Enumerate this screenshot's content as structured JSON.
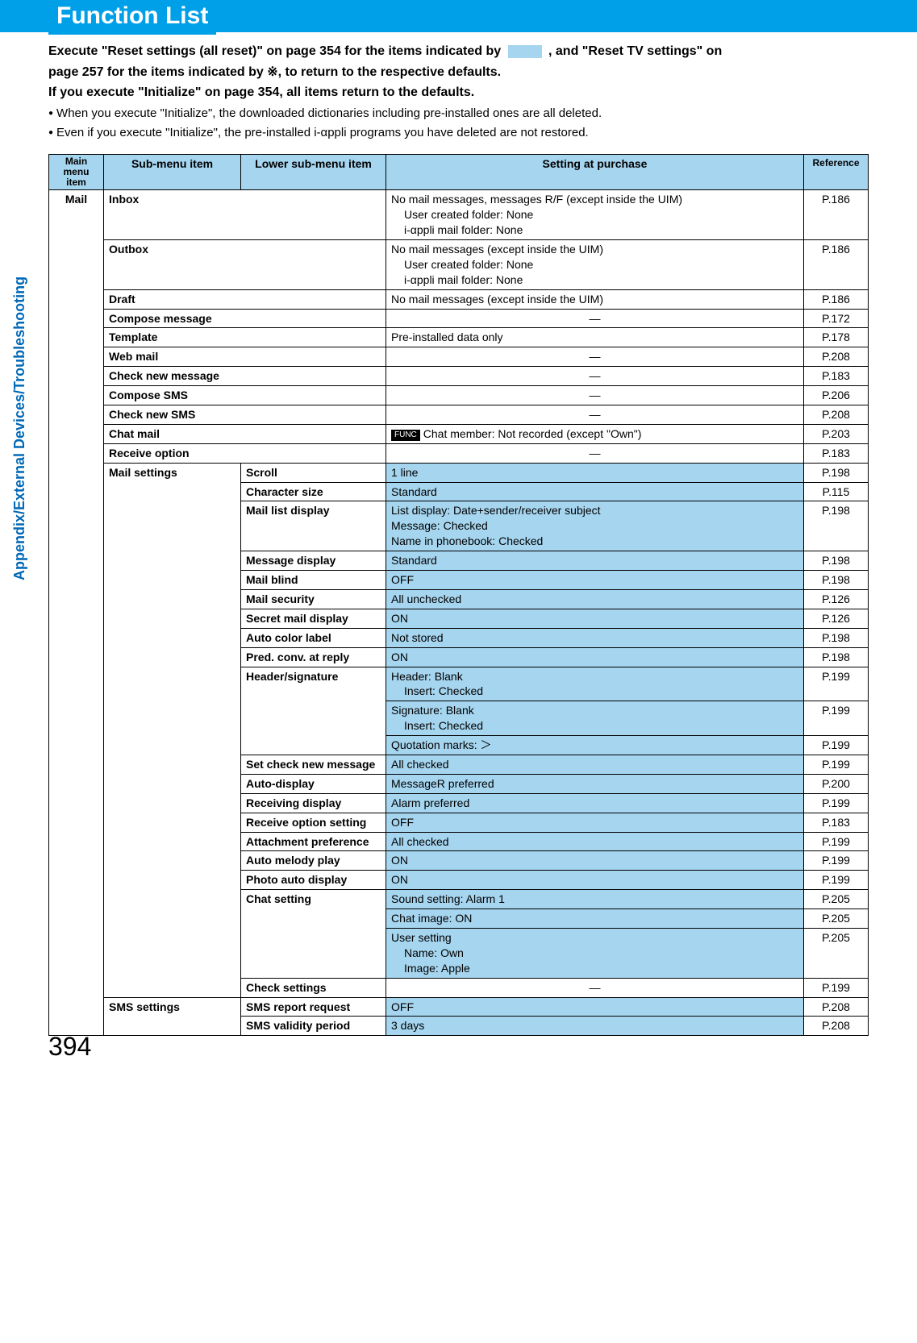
{
  "title": "Function List",
  "intro": {
    "line1a": "Execute \"Reset settings (all reset)\" on page 354 for the items indicated by ",
    "line1b": ", and \"Reset TV settings\" on",
    "line2": "page 257 for the items indicated by ※, to return to the respective defaults.",
    "line3": " If you execute \"Initialize\" on page 354, all items return to the defaults.",
    "bullet1": "When you execute \"Initialize\", the downloaded dictionaries including pre-installed ones are all deleted.",
    "bullet2": "Even if you execute \"Initialize\", the pre-installed i-αppli programs you have deleted are not restored."
  },
  "sidebar_text": "Appendix/External Devices/Troubleshooting",
  "page_number": "394",
  "headers": {
    "main": "Main\nmenu item",
    "sub": "Sub-menu item",
    "lower": "Lower sub-menu item",
    "setting": "Setting at purchase",
    "ref": "Reference"
  },
  "main_item": "Mail",
  "func_label": "FUNC",
  "dash": "—",
  "rows": {
    "inbox": {
      "sub": "Inbox",
      "setting_l1": "No mail messages, messages R/F (except inside the UIM)",
      "setting_l2": "User created folder: None",
      "setting_l3": "i-αppli mail folder: None",
      "ref": "P.186"
    },
    "outbox": {
      "sub": "Outbox",
      "setting_l1": "No mail messages (except inside the UIM)",
      "setting_l2": "User created folder: None",
      "setting_l3": "i-αppli mail folder: None",
      "ref": "P.186"
    },
    "draft": {
      "sub": "Draft",
      "setting": "No mail messages (except inside the UIM)",
      "ref": "P.186"
    },
    "compose": {
      "sub": "Compose message",
      "ref": "P.172"
    },
    "template": {
      "sub": "Template",
      "setting": "Pre-installed data only",
      "ref": "P.178"
    },
    "webmail": {
      "sub": "Web mail",
      "ref": "P.208"
    },
    "checknew": {
      "sub": "Check new message",
      "ref": "P.183"
    },
    "composesms": {
      "sub": "Compose SMS",
      "ref": "P.206"
    },
    "checknewsms": {
      "sub": "Check new SMS",
      "ref": "P.208"
    },
    "chatmail": {
      "sub": "Chat mail",
      "setting": "Chat member: Not recorded (except \"Own\")",
      "ref": "P.203"
    },
    "recvopt": {
      "sub": "Receive option",
      "ref": "P.183"
    },
    "mailsettings": {
      "sub": "Mail settings"
    },
    "scroll": {
      "lower": "Scroll",
      "setting": "1 line",
      "ref": "P.198"
    },
    "charsize": {
      "lower": "Character size",
      "setting": "Standard",
      "ref": "P.115"
    },
    "maillist": {
      "lower": "Mail list display",
      "l1": "List display: Date+sender/receiver subject",
      "l2": "Message: Checked",
      "l3": "Name in phonebook: Checked",
      "ref": "P.198"
    },
    "msgdisp": {
      "lower": "Message display",
      "setting": "Standard",
      "ref": "P.198"
    },
    "mailblind": {
      "lower": "Mail blind",
      "setting": "OFF",
      "ref": "P.198"
    },
    "mailsec": {
      "lower": "Mail security",
      "setting": "All unchecked",
      "ref": "P.126"
    },
    "secretmail": {
      "lower": "Secret mail display",
      "setting": "ON",
      "ref": "P.126"
    },
    "autocolor": {
      "lower": "Auto color label",
      "setting": "Not stored",
      "ref": "P.198"
    },
    "predconv": {
      "lower": "Pred. conv. at reply",
      "setting": "ON",
      "ref": "P.198"
    },
    "headersig": {
      "lower": "Header/signature",
      "l1": "Header: Blank",
      "l2": "Insert: Checked",
      "ref1": "P.199",
      "l3": "Signature: Blank",
      "l4": "Insert: Checked",
      "ref2": "P.199",
      "l5": "Quotation marks: ＞",
      "ref3": "P.199"
    },
    "setchecknew": {
      "lower": "Set check new message",
      "setting": "All checked",
      "ref": "P.199"
    },
    "autodisp": {
      "lower": "Auto-display",
      "setting": "MessageR preferred",
      "ref": "P.200"
    },
    "recvdisp": {
      "lower": "Receiving display",
      "setting": "Alarm preferred",
      "ref": "P.199"
    },
    "recvoptset": {
      "lower": "Receive option setting",
      "setting": "OFF",
      "ref": "P.183"
    },
    "attachpref": {
      "lower": "Attachment preference",
      "setting": "All checked",
      "ref": "P.199"
    },
    "automel": {
      "lower": "Auto melody play",
      "setting": "ON",
      "ref": "P.199"
    },
    "photoauto": {
      "lower": "Photo auto display",
      "setting": "ON",
      "ref": "P.199"
    },
    "chatset": {
      "lower": "Chat setting",
      "l1": "Sound setting: Alarm 1",
      "ref1": "P.205",
      "l2": "Chat image: ON",
      "ref2": "P.205",
      "l3": "User setting",
      "l4": "Name: Own",
      "l5": "Image: Apple",
      "ref3": "P.205"
    },
    "checkset": {
      "lower": "Check settings",
      "ref": "P.199"
    },
    "smssettings": {
      "sub": "SMS settings"
    },
    "smsreport": {
      "lower": "SMS report request",
      "setting": "OFF",
      "ref": "P.208"
    },
    "smsvalid": {
      "lower": "SMS validity period",
      "setting": "3 days",
      "ref": "P.208"
    }
  }
}
